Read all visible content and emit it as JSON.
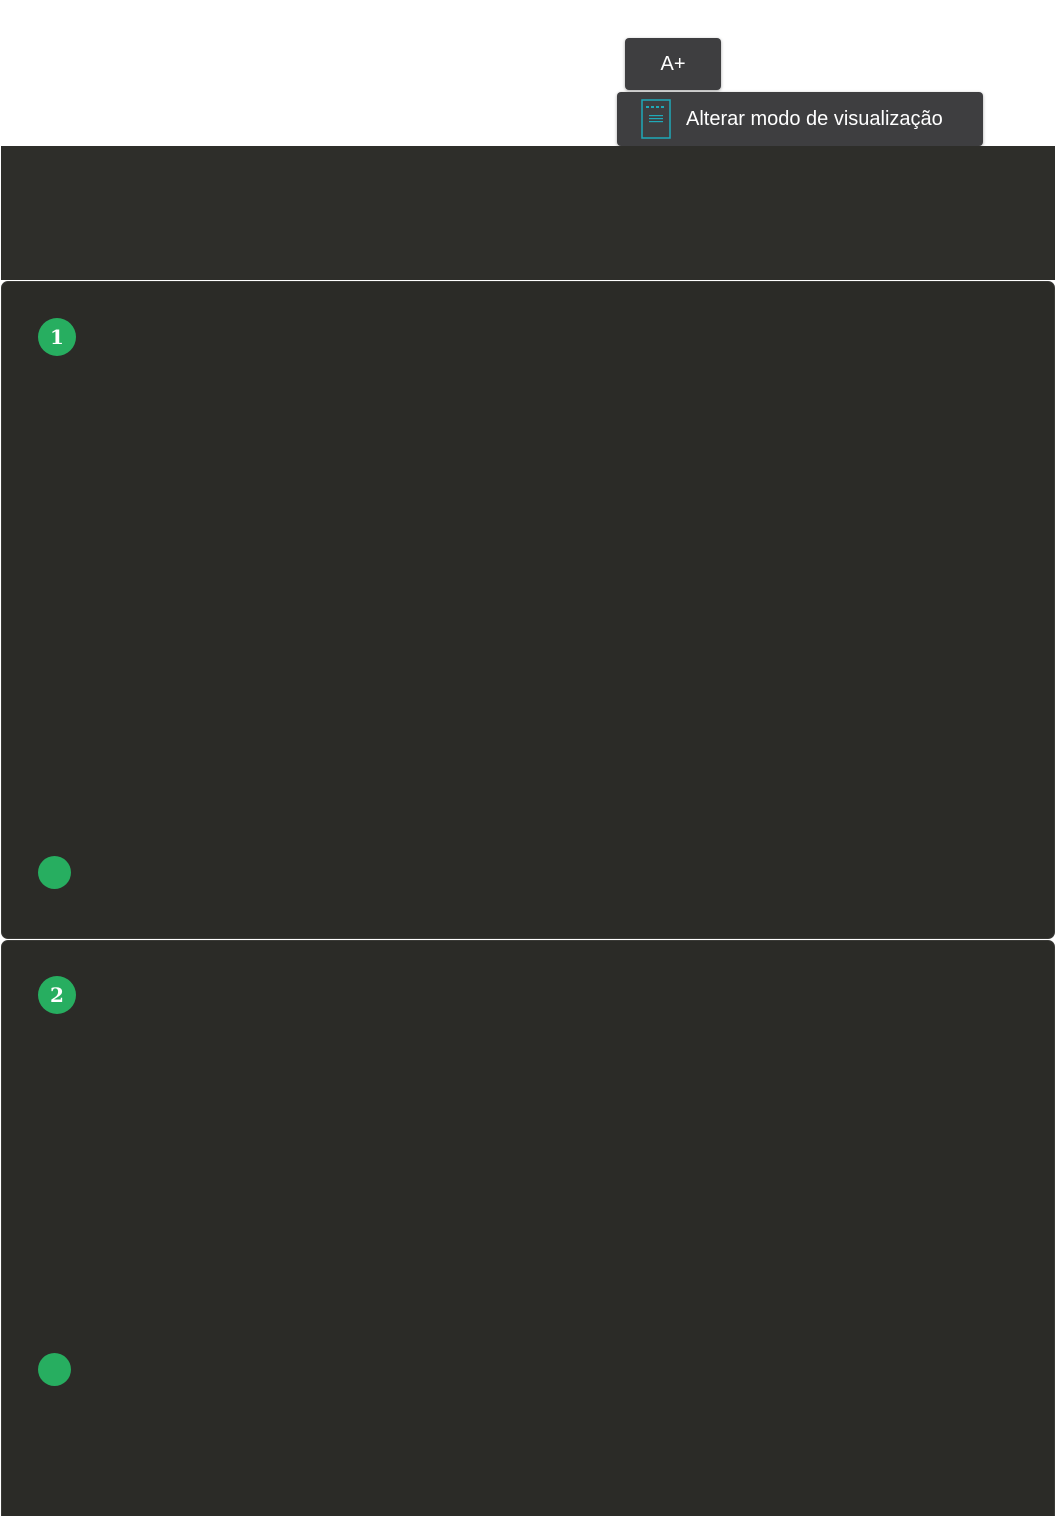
{
  "toolbar": {
    "font_size_label": "A+",
    "view_mode_label": "Alterar modo de visualização",
    "view_mode_icon": "document-reader-icon",
    "icon_color": "#1fa9b8"
  },
  "cards": [
    {
      "step": "1"
    },
    {
      "step": "2"
    }
  ],
  "colors": {
    "accent_green": "#27ae60",
    "card_background": "#2b2b27",
    "button_background": "#3e3e40"
  }
}
